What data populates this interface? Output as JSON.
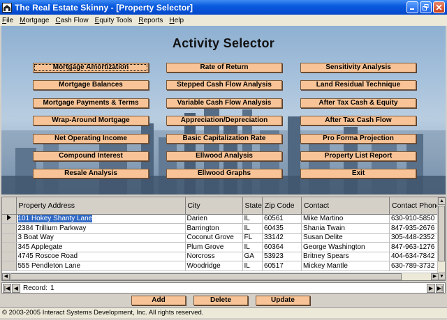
{
  "window": {
    "title": "The Real Estate Skinny - [Property Selector]"
  },
  "menu": [
    "File",
    "Mortgage",
    "Cash Flow",
    "Equity Tools",
    "Reports",
    "Help"
  ],
  "hero": {
    "title": "Activity Selector",
    "buttons": [
      [
        "Mortgage Amortization",
        "Rate of Return",
        "Sensitivity Analysis"
      ],
      [
        "Mortgage Balances",
        "Stepped Cash Flow Analysis",
        "Land Residual Technique"
      ],
      [
        "Mortgage Payments & Terms",
        "Variable Cash Flow Analysis",
        "After Tax Cash & Equity"
      ],
      [
        "Wrap-Around Mortgage",
        "Appreciation/Depreciation",
        "After Tax Cash Flow"
      ],
      [
        "Net Operating Income",
        "Basic Capitalization Rate",
        "Pro Forma Projection"
      ],
      [
        "Compound Interest",
        "Ellwood Analysis",
        "Property List Report"
      ],
      [
        "Resale Analysis",
        "Ellwood Graphs",
        "Exit"
      ]
    ]
  },
  "grid": {
    "columns": [
      "Property Address",
      "City",
      "State",
      "Zip Code",
      "Contact",
      "Contact Phone"
    ],
    "rows": [
      [
        "101 Hokey Shanty Lane",
        "Darien",
        "IL",
        "60561",
        "Mike Martino",
        "630-910-5850"
      ],
      [
        "2384 Trillium Parkway",
        "Barrington",
        "IL",
        "60435",
        "Shania Twain",
        "847-935-2676"
      ],
      [
        "3 Boat Way",
        "Coconut Grove",
        "FL",
        "33142",
        "Susan Delite",
        "305-448-2352"
      ],
      [
        "345 Applegate",
        "Plum Grove",
        "IL",
        "60364",
        "George Washington",
        "847-963-1276"
      ],
      [
        "4745 Roscoe Road",
        "Norcross",
        "GA",
        "53923",
        "Britney Spears",
        "404-634-7842"
      ],
      [
        "555 Pendleton Lane",
        "Woodridge",
        "IL",
        "60517",
        "Mickey Mantle",
        "630-789-3732"
      ]
    ]
  },
  "recnav": {
    "label": "Record:",
    "value": "1"
  },
  "actions": {
    "add": "Add",
    "delete": "Delete",
    "update": "Update"
  },
  "status": {
    "text": "© 2003-2005 Interact Systems Development, Inc.   All rights reserved."
  }
}
